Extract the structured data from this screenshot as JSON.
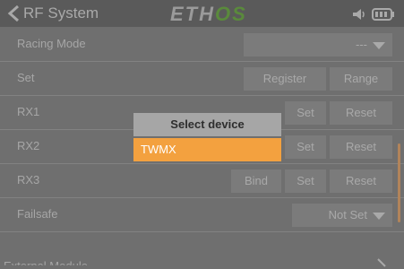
{
  "header": {
    "title": "RF System",
    "logo_main": "ETH",
    "logo_tail": "OS"
  },
  "rows": {
    "racing_mode": {
      "label": "Racing Mode",
      "value": "---"
    },
    "set": {
      "label": "Set",
      "register": "Register",
      "range": "Range"
    },
    "rx1": {
      "label": "RX1",
      "set": "Set",
      "reset": "Reset"
    },
    "rx2": {
      "label": "RX2",
      "set": "Set",
      "reset": "Reset"
    },
    "rx3": {
      "label": "RX3",
      "bind": "Bind",
      "set": "Set",
      "reset": "Reset"
    },
    "failsafe": {
      "label": "Failsafe",
      "value": "Not Set"
    },
    "external_module": {
      "label": "External Module"
    }
  },
  "popup": {
    "title": "Select device",
    "options": [
      "TWMX"
    ],
    "selected_index": 0
  },
  "colors": {
    "accent": "#f3a13f",
    "background": "#6f6f6f",
    "header": "#5a5a5a",
    "popup_title_bg": "#a6a6a6"
  },
  "icons": [
    "back-chevron-icon",
    "volume-icon",
    "battery-icon"
  ]
}
